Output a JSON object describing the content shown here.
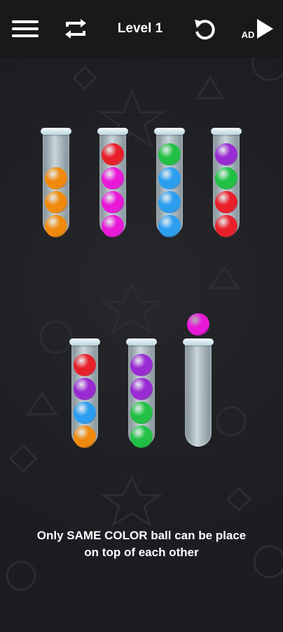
{
  "header": {
    "menu_icon": "hamburger-menu-icon",
    "shuffle_icon": "repeat-arrows-icon",
    "level_label": "Level 1",
    "undo_icon": "undo-arrow-icon",
    "ad_label": "AD"
  },
  "colors": {
    "orange": "#f08a0e",
    "red": "#e8202a",
    "magenta": "#e81ad8",
    "green": "#22c145",
    "blue": "#2b9ef0",
    "purple": "#9a2bd2",
    "background": "#1d1e21",
    "topbar": "#181919"
  },
  "tubes": [
    {
      "balls": [
        "orange",
        "orange",
        "orange"
      ]
    },
    {
      "balls": [
        "red",
        "magenta",
        "magenta",
        "magenta"
      ]
    },
    {
      "balls": [
        "green",
        "blue",
        "blue",
        "blue"
      ]
    },
    {
      "balls": [
        "purple",
        "green",
        "red",
        "red"
      ]
    },
    {
      "balls": [
        "red",
        "purple",
        "blue",
        "orange"
      ]
    },
    {
      "balls": [
        "purple",
        "purple",
        "green",
        "green"
      ]
    },
    {
      "balls": []
    }
  ],
  "lifted_ball": {
    "color": "magenta",
    "tube_index": 6
  },
  "hint": {
    "line1": "Only SAME COLOR ball can be place",
    "line2": "on top of each other"
  }
}
